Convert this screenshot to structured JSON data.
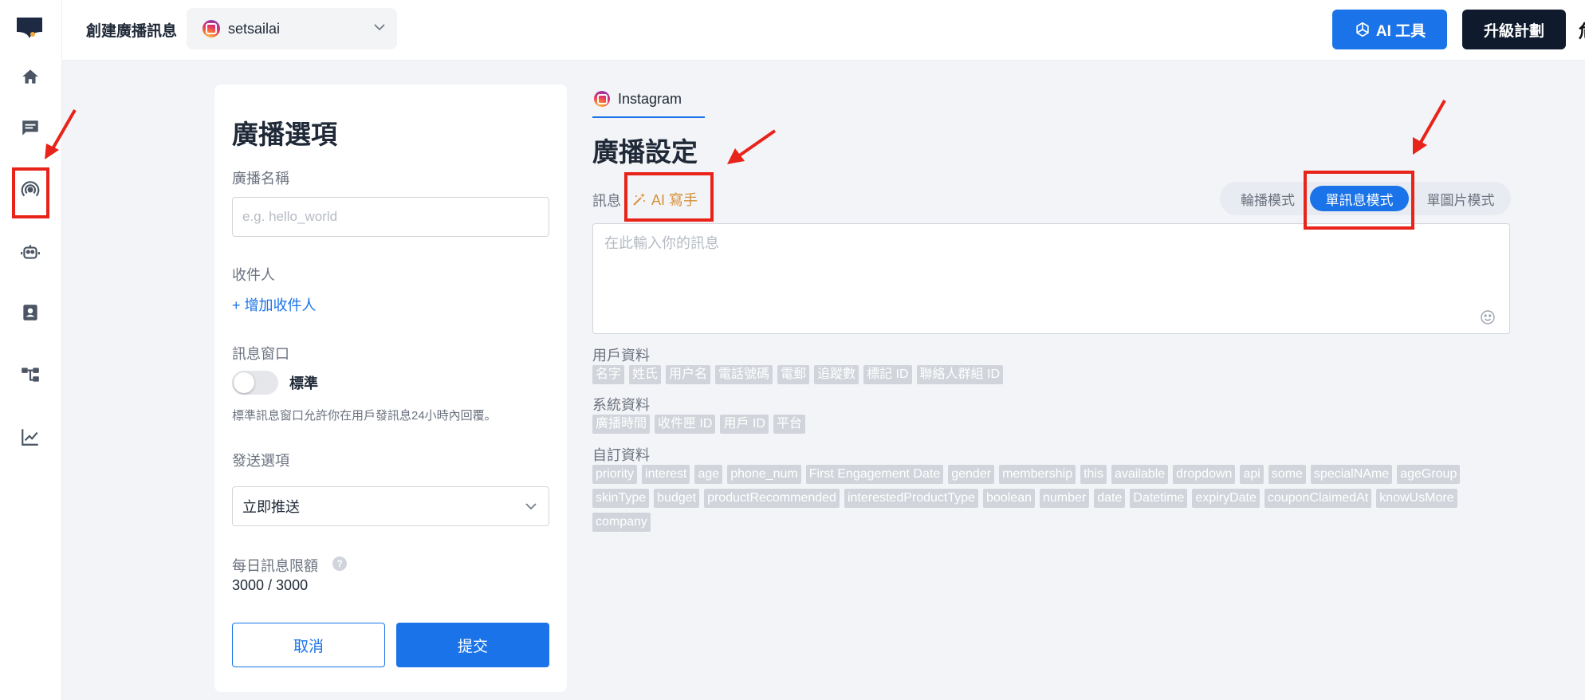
{
  "app": {
    "page_title": "創建廣播訊息",
    "account_name": "setsailai"
  },
  "header": {
    "ai_tools_label": "AI 工具",
    "upgrade_label": "升級計劃",
    "edge_glyph": "危"
  },
  "sidebar": {
    "items": [
      {
        "icon": "home-icon"
      },
      {
        "icon": "chat-icon"
      },
      {
        "icon": "broadcast-icon"
      },
      {
        "icon": "bot-icon"
      },
      {
        "icon": "contacts-icon"
      },
      {
        "icon": "flow-icon"
      },
      {
        "icon": "analytics-icon"
      }
    ]
  },
  "left_panel": {
    "title": "廣播選項",
    "name_label": "廣播名稱",
    "name_placeholder": "e.g. hello_world",
    "recipient_label": "收件人",
    "add_recipient": "+ 增加收件人",
    "window_label": "訊息窗口",
    "window_toggle_label": "標準",
    "window_hint": "標準訊息窗口允許你在用戶發訊息24小時內回覆。",
    "send_label": "發送選項",
    "send_value": "立即推送",
    "quota_label": "每日訊息限額",
    "quota_help": "?",
    "quota_value": "3000 / 3000",
    "cancel_label": "取消",
    "submit_label": "提交"
  },
  "right_panel": {
    "tab_label": "Instagram",
    "title": "廣播設定",
    "message_label": "訊息",
    "ai_writer_label": "AI 寫手",
    "modes": [
      "輪播模式",
      "單訊息模式",
      "單圖片模式"
    ],
    "active_mode": "單訊息模式",
    "message_placeholder": "在此輸入你的訊息",
    "user_data_label": "用戶資料",
    "user_data_tags": [
      "名字",
      "姓氏",
      "用户名",
      "電話號碼",
      "電郵",
      "追蹤數",
      "標記 ID",
      "聯絡人群組 ID"
    ],
    "system_data_label": "系統資料",
    "system_data_tags": [
      "廣播時間",
      "收件匣 ID",
      "用戶 ID",
      "平台"
    ],
    "custom_data_label": "自訂資料",
    "custom_data_tags": [
      "priority",
      "interest",
      "age",
      "phone_num",
      "First Engagement Date",
      "gender",
      "membership",
      "this",
      "available",
      "dropdown",
      "api",
      "some",
      "specialNAme",
      "ageGroup",
      "skinType",
      "budget",
      "productRecommended",
      "interestedProductType",
      "boolean",
      "number",
      "date",
      "Datetime",
      "expiryDate",
      "couponClaimedAt",
      "knowUsMore",
      "company"
    ]
  },
  "colors": {
    "primary": "#1a73e8",
    "dark": "#0f1b2d",
    "annotation": "#e8231a",
    "ai_writer": "#d4913b",
    "tag_bg": "#d1d5db"
  }
}
